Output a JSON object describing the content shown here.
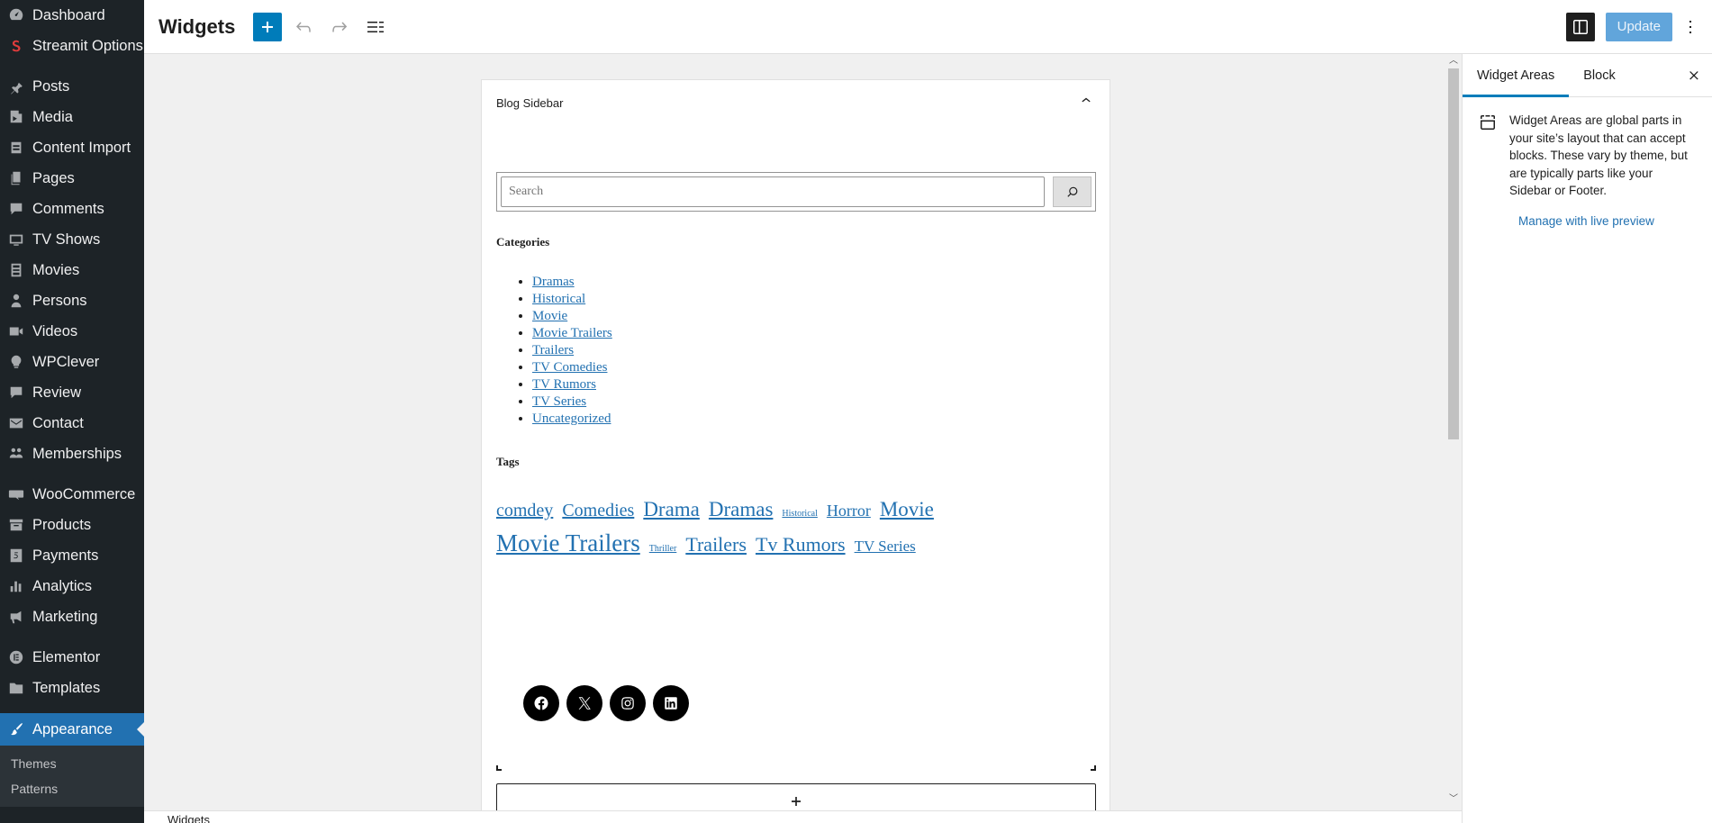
{
  "admin_menu": {
    "items": [
      {
        "label": "Dashboard",
        "icon": "dashboard-icon"
      },
      {
        "label": "Streamit Options",
        "icon": "streamit-icon"
      },
      {
        "label": "Posts",
        "icon": "pin-icon"
      },
      {
        "label": "Media",
        "icon": "media-icon"
      },
      {
        "label": "Content Import",
        "icon": "content-import-icon"
      },
      {
        "label": "Pages",
        "icon": "pages-icon"
      },
      {
        "label": "Comments",
        "icon": "comments-icon"
      },
      {
        "label": "TV Shows",
        "icon": "tv-icon"
      },
      {
        "label": "Movies",
        "icon": "film-icon"
      },
      {
        "label": "Persons",
        "icon": "person-icon"
      },
      {
        "label": "Videos",
        "icon": "video-icon"
      },
      {
        "label": "WPClever",
        "icon": "lightbulb-icon"
      },
      {
        "label": "Review",
        "icon": "review-icon"
      },
      {
        "label": "Contact",
        "icon": "mail-icon"
      },
      {
        "label": "Memberships",
        "icon": "groups-icon"
      },
      {
        "label": "WooCommerce",
        "icon": "woo-icon"
      },
      {
        "label": "Products",
        "icon": "archive-icon"
      },
      {
        "label": "Payments",
        "icon": "payments-icon"
      },
      {
        "label": "Analytics",
        "icon": "bar-chart-icon"
      },
      {
        "label": "Marketing",
        "icon": "megaphone-icon"
      },
      {
        "label": "Elementor",
        "icon": "elementor-icon"
      },
      {
        "label": "Templates",
        "icon": "folder-icon"
      },
      {
        "label": "Appearance",
        "icon": "brush-icon"
      }
    ],
    "submenu": [
      "Themes",
      "Patterns"
    ]
  },
  "header": {
    "title": "Widgets",
    "update_label": "Update"
  },
  "widget_area": {
    "title": "Blog Sidebar",
    "search_placeholder": "Search",
    "categories_heading": "Categories",
    "categories": [
      "Dramas",
      "Historical",
      "Movie",
      "Movie Trailers",
      "Trailers",
      "TV Comedies",
      "TV Rumors",
      "TV Series",
      "Uncategorized"
    ],
    "tags_heading": "Tags",
    "tags": [
      {
        "label": "comdey",
        "size": 20
      },
      {
        "label": "Comedies",
        "size": 20
      },
      {
        "label": "Drama",
        "size": 23
      },
      {
        "label": "Dramas",
        "size": 23
      },
      {
        "label": "Historical",
        "size": 10
      },
      {
        "label": "Horror",
        "size": 18
      },
      {
        "label": "Movie",
        "size": 23
      },
      {
        "label": "Movie Trailers",
        "size": 27
      },
      {
        "label": "Thriller",
        "size": 10
      },
      {
        "label": "Trailers",
        "size": 22
      },
      {
        "label": "Tv Rumors",
        "size": 22
      },
      {
        "label": "TV Series",
        "size": 17
      }
    ],
    "social": [
      "facebook-icon",
      "x-icon",
      "instagram-icon",
      "linkedin-icon"
    ]
  },
  "footer": {
    "breadcrumb": "Widgets"
  },
  "settings_panel": {
    "tabs": [
      "Widget Areas",
      "Block"
    ],
    "description": "Widget Areas are global parts in your site’s layout that can accept blocks. These vary by theme, but are typically parts like your Sidebar or Footer.",
    "manage_link": "Manage with live preview"
  },
  "colors": {
    "accent": "#007cba",
    "admin_bg": "#1d2327",
    "current_menu": "#2271b1",
    "link": "#2271b1"
  }
}
